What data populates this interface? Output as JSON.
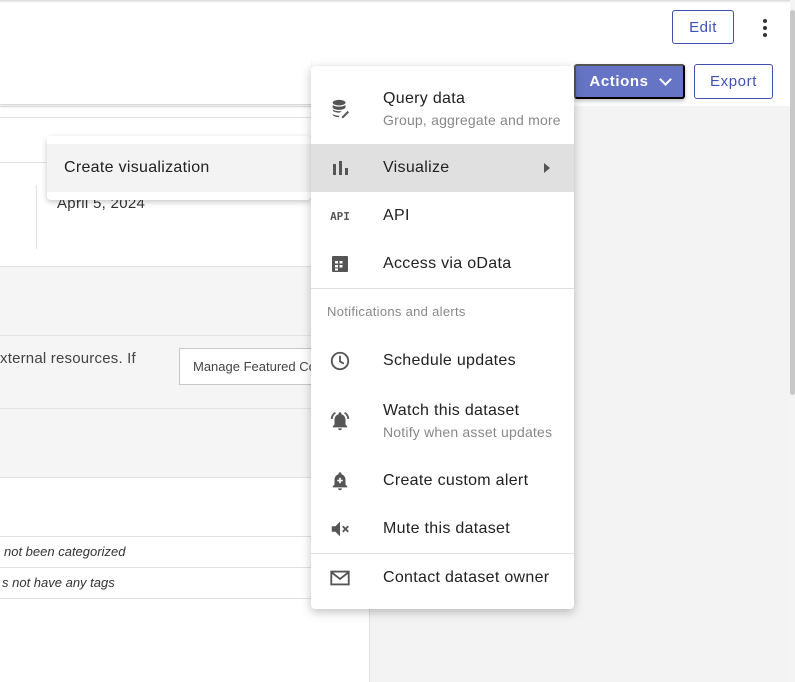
{
  "header": {
    "edit_label": "Edit",
    "more_icon": "kebab-menu-icon"
  },
  "toolbar": {
    "actions_label": "Actions",
    "export_label": "Export"
  },
  "background": {
    "date": "April 5, 2024",
    "external_text": "xternal resources. If",
    "featured_button": "Manage Featured Co",
    "category_note": "not been categorized",
    "tags_note": "s not have any tags"
  },
  "submenu": {
    "create_visualization": "Create visualization"
  },
  "menu": {
    "query": {
      "label": "Query data",
      "sub": "Group, aggregate and more",
      "icon": "database-edit-icon"
    },
    "visualize": {
      "label": "Visualize",
      "icon": "bar-chart-icon"
    },
    "api": {
      "label": "API",
      "icon": "api-icon",
      "icon_text": "API"
    },
    "odata": {
      "label": "Access via oData",
      "icon": "table-icon"
    },
    "section_notifications": "Notifications and alerts",
    "schedule": {
      "label": "Schedule updates",
      "icon": "clock-icon"
    },
    "watch": {
      "label": "Watch this dataset",
      "sub": "Notify when asset updates",
      "icon": "bell-ring-icon"
    },
    "custom_alert": {
      "label": "Create custom alert",
      "icon": "bell-plus-icon"
    },
    "mute": {
      "label": "Mute this dataset",
      "icon": "volume-off-icon"
    },
    "contact": {
      "label": "Contact dataset owner",
      "icon": "mail-icon"
    }
  },
  "colors": {
    "primary": "#3f51b5",
    "actions_bg": "#6574c4",
    "active_item": "#e0e0e0"
  }
}
